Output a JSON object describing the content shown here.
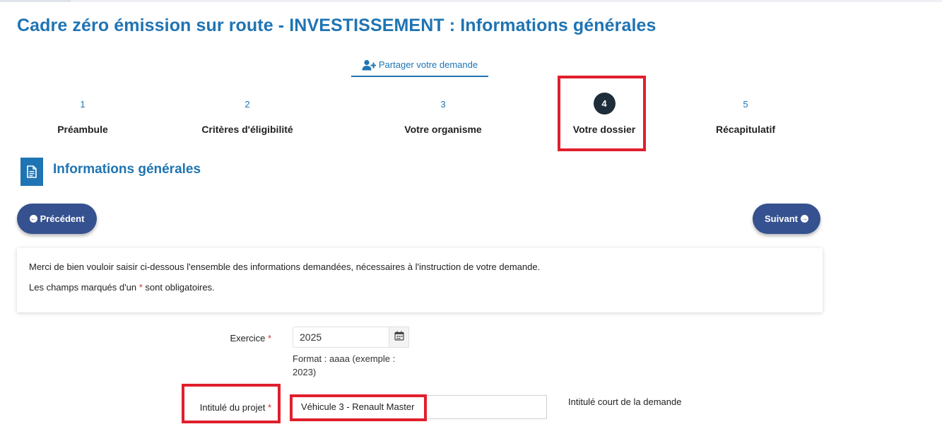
{
  "page": {
    "title": "Cadre zéro émission sur route - INVESTISSEMENT : Informations générales"
  },
  "share": {
    "label": "Partager votre demande"
  },
  "steps": [
    {
      "num": "1",
      "label": "Préambule"
    },
    {
      "num": "2",
      "label": "Critères d'éligibilité"
    },
    {
      "num": "3",
      "label": "Votre organisme"
    },
    {
      "num": "4",
      "label": "Votre dossier"
    },
    {
      "num": "5",
      "label": "Récapitulatif"
    }
  ],
  "active_step": 4,
  "section": {
    "title": "Informations générales"
  },
  "nav": {
    "prev_label": "Précédent",
    "next_label": "Suivant"
  },
  "info": {
    "line1": "Merci de bien vouloir saisir ci-dessous l'ensemble des informations demandées, nécessaires à l'instruction de votre demande.",
    "line2_before": "Les champs marqués d'un",
    "required_marker": "*",
    "line2_after": "sont obligatoires."
  },
  "form": {
    "exercice": {
      "label": "Exercice",
      "value": "2025",
      "hint": "Format : aaaa (exemple : 2023)"
    },
    "intitule": {
      "label": "Intitulé du projet",
      "value": "Véhicule 3 - Renault Master",
      "help": "Intitulé court de la demande"
    }
  },
  "colors": {
    "primary": "#1f74b3",
    "button": "#35518f",
    "highlight": "#e01f2d",
    "required": "#d42d3a",
    "active_step": "#1e2d3a"
  }
}
